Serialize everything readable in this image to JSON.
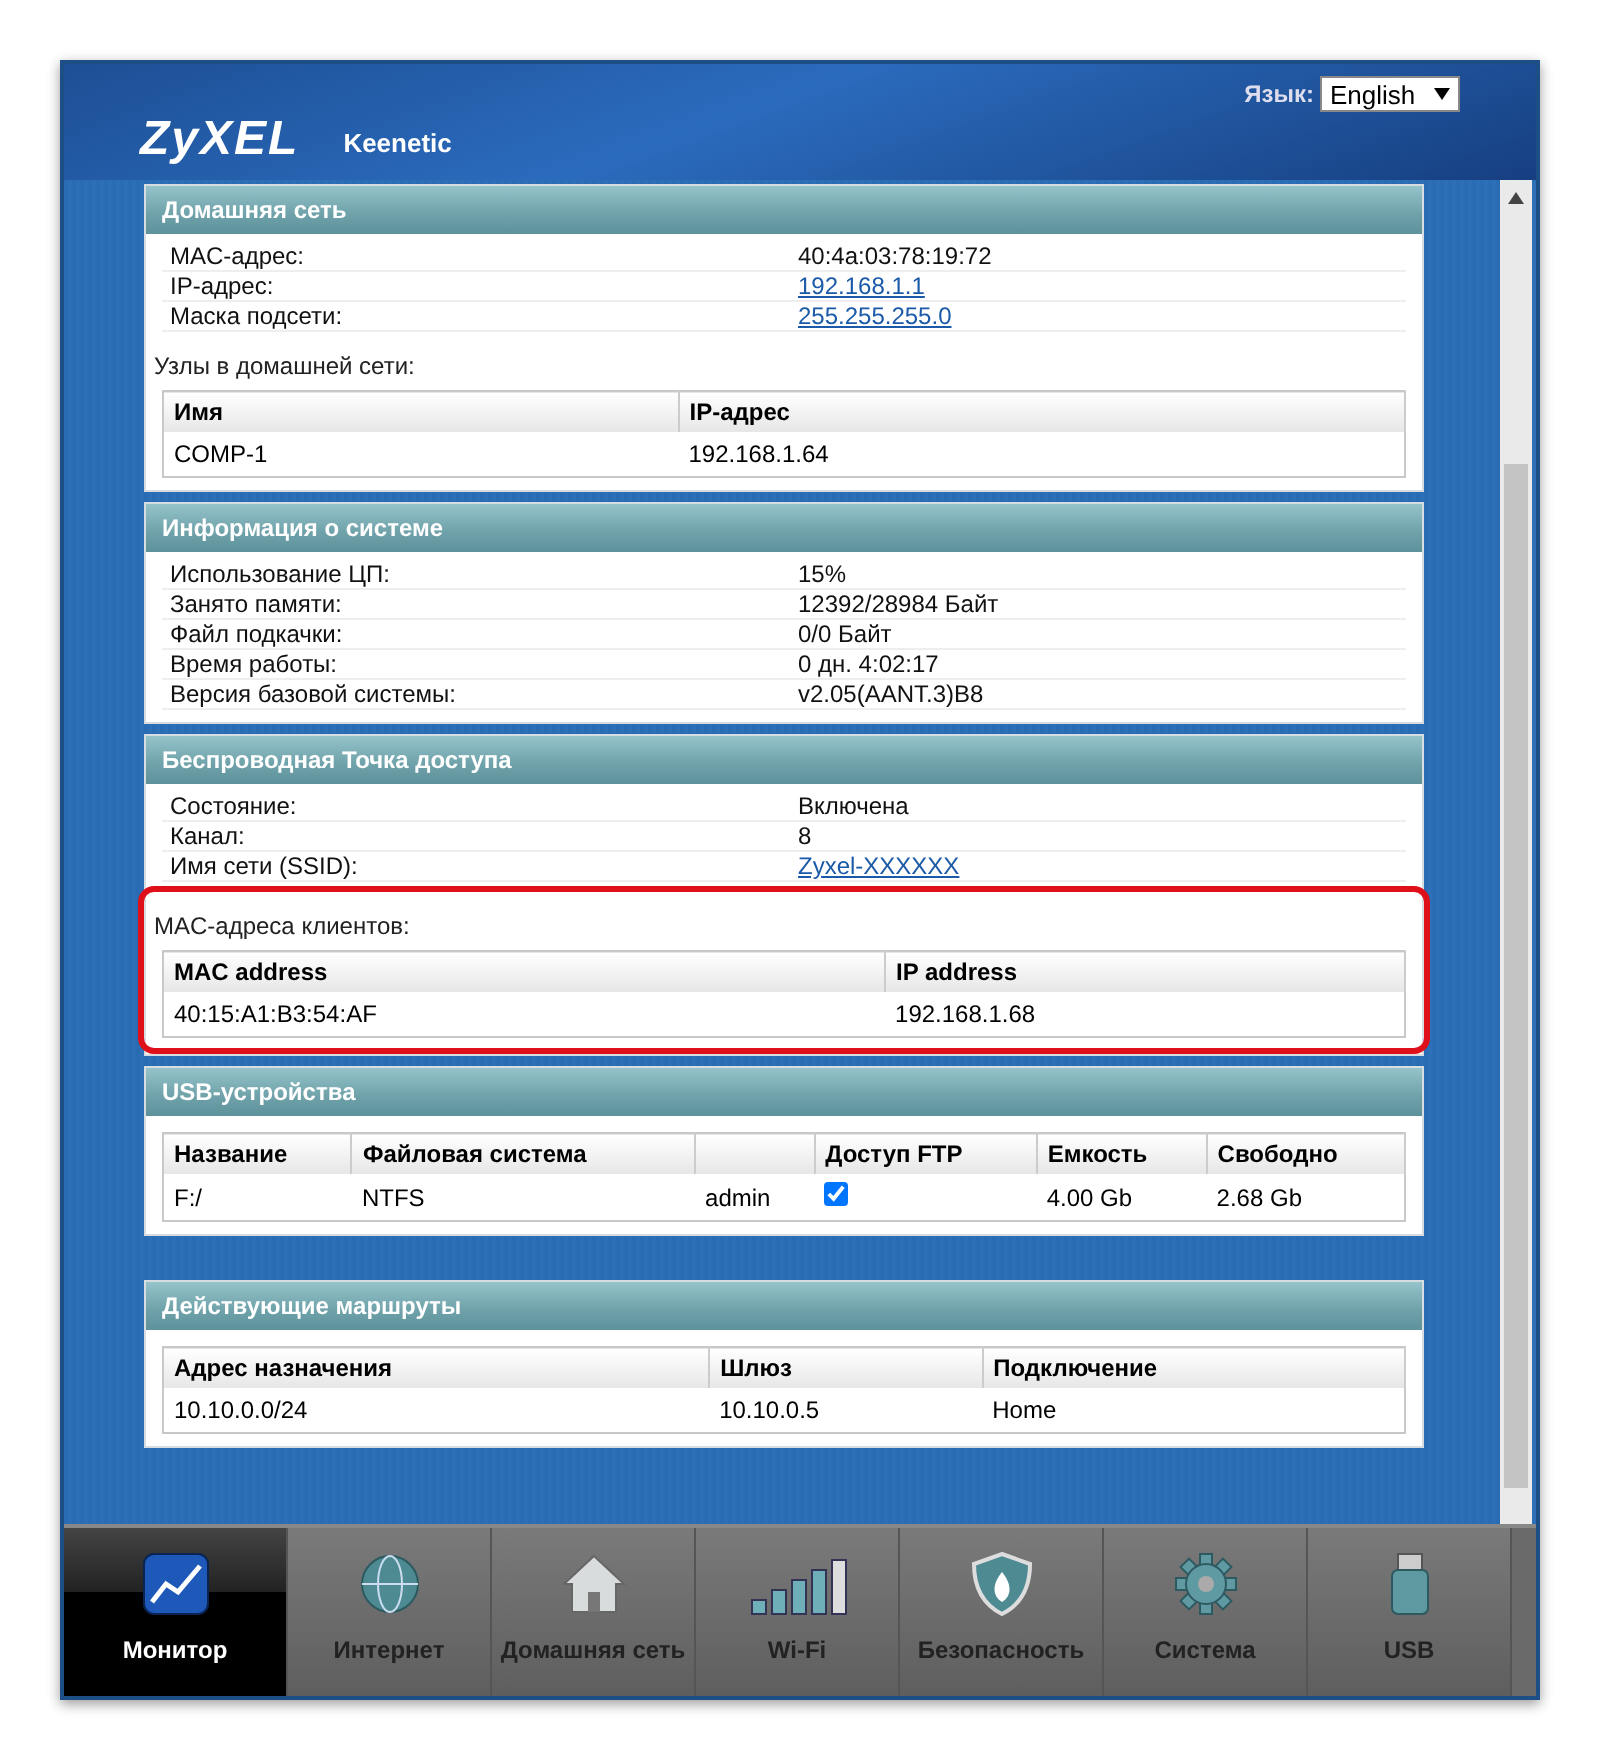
{
  "header": {
    "logo": "ZyXEL",
    "product": "Keenetic",
    "language_label": "Язык:",
    "language": "English"
  },
  "panels": [
    {
      "title": "Домашняя сеть",
      "rows": [
        {
          "label": "MAC-адрес:",
          "value": "40:4a:03:78:19:72",
          "link": false
        },
        {
          "label": "IP-адрес:",
          "value": "192.168.1.1",
          "link": true
        },
        {
          "label": "Маска подсети:",
          "value": "255.255.255.0",
          "link": true
        }
      ],
      "subtitle": "Узлы в домашней сети:",
      "highlighted": false,
      "table": {
        "columns": [
          "Имя",
          "IP-адрес"
        ],
        "rows": [
          [
            "COMP-1",
            "192.168.1.64"
          ]
        ]
      }
    },
    {
      "title": "Информация о системе",
      "rows": [
        {
          "label": "Использование ЦП:",
          "value": "15%",
          "link": false
        },
        {
          "label": "Занято памяти:",
          "value": "12392/28984 Байт",
          "link": false
        },
        {
          "label": "Файл подкачки:",
          "value": "0/0 Байт",
          "link": false
        },
        {
          "label": "Время работы:",
          "value": "0 дн. 4:02:17",
          "link": false
        },
        {
          "label": "Версия базовой системы:",
          "value": "v2.05(AANT.3)B8",
          "link": false
        }
      ]
    },
    {
      "title": "Беспроводная Точка доступа",
      "rows": [
        {
          "label": "Состояние:",
          "value": "Включена",
          "link": false
        },
        {
          "label": "Канал:",
          "value": "8",
          "link": false
        },
        {
          "label": "Имя сети (SSID):",
          "value": "Zyxel-XXXXXX",
          "link": true
        }
      ],
      "subtitle": "MAC-адреса клиентов:",
      "highlighted": true,
      "table": {
        "columns": [
          "MAC address",
          "IP address"
        ],
        "rows": [
          [
            "40:15:A1:B3:54:AF",
            "192.168.1.68"
          ]
        ]
      }
    },
    {
      "title": "USB-устройства",
      "highlighted": false,
      "table": {
        "columns": [
          "Название",
          "Файловая система",
          "",
          "Доступ FTP",
          "Емкость",
          "Свободно"
        ],
        "rows": [
          [
            "F:/",
            "NTFS",
            "admin",
            {
              "kind": "checkbox",
              "checked": true
            },
            "4.00 Gb",
            "2.68 Gb"
          ]
        ]
      }
    },
    {
      "title": "Действующие маршруты",
      "highlighted": false,
      "table": {
        "columns": [
          "Адрес назначения",
          "Шлюз",
          "Подключение"
        ],
        "rows": [
          [
            "10.10.0.0/24",
            "10.10.0.5",
            "Home"
          ]
        ]
      }
    }
  ],
  "nav": [
    {
      "label": "Монитор",
      "selected": true
    },
    {
      "label": "Интернет",
      "selected": false
    },
    {
      "label": "Домашняя сеть",
      "selected": false
    },
    {
      "label": "Wi-Fi",
      "selected": false
    },
    {
      "label": "Безопасность",
      "selected": false
    },
    {
      "label": "Система",
      "selected": false
    },
    {
      "label": "USB",
      "selected": false
    }
  ]
}
